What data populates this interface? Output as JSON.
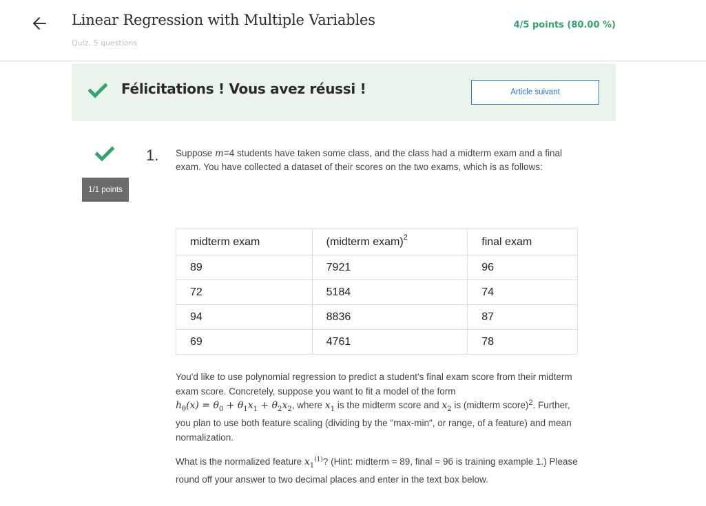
{
  "header": {
    "title": "Linear Regression with Multiple Variables",
    "subtitle": "Quiz, 5 questions",
    "score": "4/5 points (80.00 %)"
  },
  "banner": {
    "message": "Félicitations ! Vous avez réussi !",
    "next_label": "Article suivant"
  },
  "colors": {
    "success_green": "#2fa66c",
    "banner_bg": "#ebf4ea",
    "link_blue": "#2a73cc",
    "badge_gray": "#6b6b6b"
  },
  "question": {
    "number": "1.",
    "points": "1/1 points",
    "intro_before": "Suppose ",
    "intro_m": "m",
    "intro_eq": "=4",
    "intro_after": " students have taken some class, and the class had a midterm exam and a final exam. You have collected a dataset of their scores on the two exams, which is as follows:",
    "table": {
      "headers": [
        "midterm exam",
        "(midterm exam)",
        "final exam"
      ],
      "header_sup": "2",
      "rows": [
        [
          "89",
          "7921",
          "96"
        ],
        [
          "72",
          "5184",
          "74"
        ],
        [
          "94",
          "8836",
          "87"
        ],
        [
          "69",
          "4761",
          "78"
        ]
      ]
    },
    "para1_a": "You'd like to use polynomial regression to predict a student's final exam score from their midterm exam score. Concretely, suppose you want to fit a model of the form",
    "para1_formula": "hθ(x) = θ0 + θ1x1 + θ2x2",
    "para1_b": ", where ",
    "para1_c": " is the midterm score and ",
    "para1_d": " is (midterm score)",
    "para1_e": ". Further, you plan to use both feature scaling (dividing by the \"max-min\", or range, of a feature) and mean normalization.",
    "para2_a": "What is the normalized feature ",
    "para2_b": "? (Hint: midterm = 89, final = 96 is training example 1.) Please round off your answer to two decimal places and enter in the text box below."
  },
  "icons": {
    "back": "arrow-left-icon",
    "check": "checkmark-icon"
  }
}
